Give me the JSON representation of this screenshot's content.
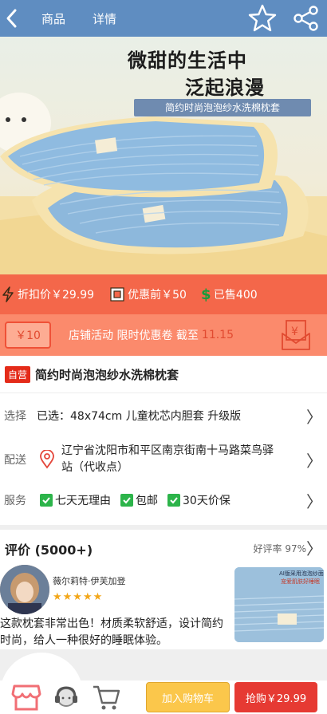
{
  "header": {
    "tabs": [
      {
        "label": "商品"
      },
      {
        "label": "详情"
      }
    ],
    "icons": [
      "back-icon",
      "star-icon",
      "share-icon"
    ]
  },
  "hero": {
    "headline_line1": "微甜的生活中",
    "headline_line2": "泛起浪漫",
    "subtitle": "简约时尚泡泡纱水洗棉枕套"
  },
  "price_strip": {
    "discount_price": "折扣价￥29.99",
    "original_price": "优惠前￥50",
    "sold": "已售400"
  },
  "coupon": {
    "amount": "￥10",
    "text": "店铺活动 限时优惠卷 截至",
    "date": "11.15"
  },
  "product": {
    "badge": "自营",
    "title": "简约时尚泡泡纱水洗棉枕套"
  },
  "options": {
    "select": {
      "label": "选择",
      "value": "已选：48x74cm 儿童枕芯内胆套 升级版"
    },
    "ship": {
      "label": "配送",
      "line1": "辽宁省沈阳市和平区南京街南十马路菜鸟驿",
      "line2": "站（代收点）"
    },
    "service": {
      "label": "服务",
      "items": [
        "七天无理由",
        "包邮",
        "30天价保"
      ]
    }
  },
  "reviews": {
    "title": "评价 (5000+)",
    "rate": "好评率 97%",
    "user": "薇尔莉特·伊芙加登",
    "stars": "★★★★★",
    "text": "这款枕套非常出色！材质柔软舒适，设计简约时尚，给人一种很好的睡眠体验。",
    "thumb_line1": "AI版采用泡泡纱面料",
    "thumb_line2": "宠爱肌肤好睡眠"
  },
  "bottom": {
    "add_cart": "加入购物车",
    "buy": "抢购￥29.99"
  },
  "colors": {
    "header": "#5f8dc1",
    "price_strip": "#f4674a",
    "coupon_strip": "#fb8a6c",
    "buy": "#e63a33",
    "cart": "#fbc74b"
  }
}
